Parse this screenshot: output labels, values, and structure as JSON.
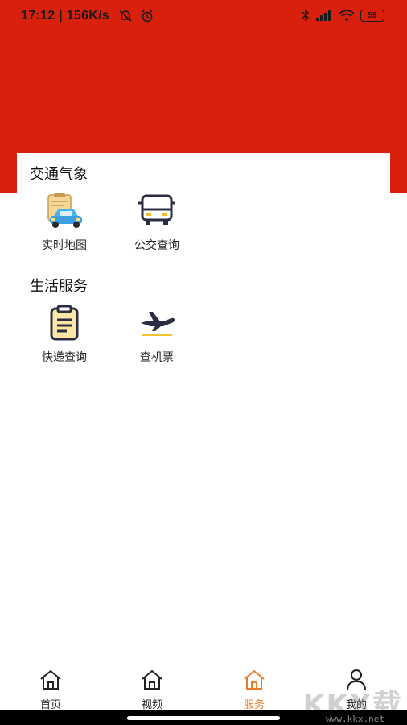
{
  "status_bar": {
    "time": "17:12",
    "speed": "156K/s",
    "battery": "59"
  },
  "sections": [
    {
      "title": "交通气象",
      "items": [
        {
          "label": "实时地图",
          "icon": "map-car-icon"
        },
        {
          "label": "公交查询",
          "icon": "bus-icon"
        }
      ]
    },
    {
      "title": "生活服务",
      "items": [
        {
          "label": "快递查询",
          "icon": "clipboard-icon"
        },
        {
          "label": "查机票",
          "icon": "airplane-icon"
        }
      ]
    }
  ],
  "tabbar": {
    "tabs": [
      {
        "label": "首页",
        "icon": "home-icon",
        "active": false
      },
      {
        "label": "视频",
        "icon": "home-icon",
        "active": false
      },
      {
        "label": "服务",
        "icon": "home-icon",
        "active": true
      },
      {
        "label": "我的",
        "icon": "person-icon",
        "active": false
      }
    ],
    "active_color": "#ef7a28"
  },
  "colors": {
    "header": "#d8200c",
    "accent_yellow": "#f2c12e"
  },
  "watermark": {
    "text": "KKX载",
    "url": "www.kkx.net"
  }
}
